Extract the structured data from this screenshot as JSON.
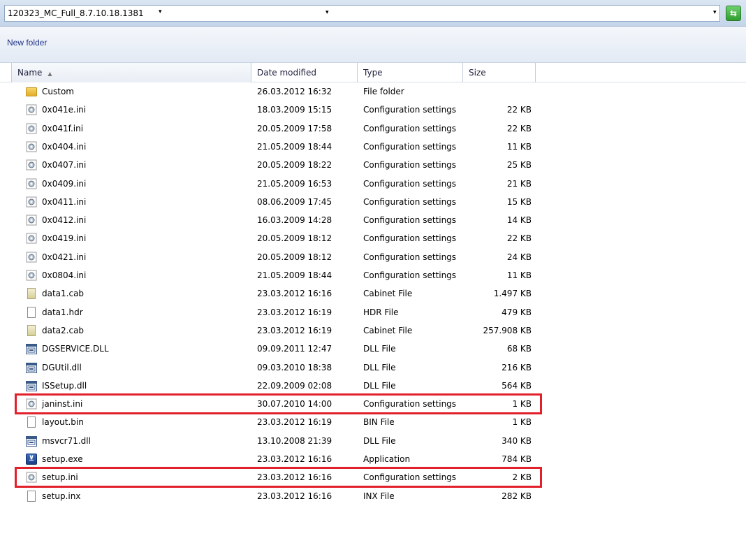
{
  "address": {
    "breadcrumb": "120323_MC_Full_8.7.10.18.1381",
    "arrow": "▾",
    "dropdown_arrow": "▾",
    "refresh_icon": "go-refresh-icon"
  },
  "toolbar": {
    "new_folder_label": "New folder"
  },
  "columns": {
    "name": "Name",
    "name_sort": "▲",
    "date": "Date modified",
    "type": "Type",
    "size": "Size"
  },
  "files": [
    {
      "name": "Custom",
      "date": "26.03.2012 16:32",
      "type": "File folder",
      "size": "",
      "icon": "folder-icon"
    },
    {
      "name": "0x041e.ini",
      "date": "18.03.2009 15:15",
      "type": "Configuration settings",
      "size": "22 KB",
      "icon": "ini-file-icon"
    },
    {
      "name": "0x041f.ini",
      "date": "20.05.2009 17:58",
      "type": "Configuration settings",
      "size": "22 KB",
      "icon": "ini-file-icon"
    },
    {
      "name": "0x0404.ini",
      "date": "21.05.2009 18:44",
      "type": "Configuration settings",
      "size": "11 KB",
      "icon": "ini-file-icon"
    },
    {
      "name": "0x0407.ini",
      "date": "20.05.2009 18:22",
      "type": "Configuration settings",
      "size": "25 KB",
      "icon": "ini-file-icon"
    },
    {
      "name": "0x0409.ini",
      "date": "21.05.2009 16:53",
      "type": "Configuration settings",
      "size": "21 KB",
      "icon": "ini-file-icon"
    },
    {
      "name": "0x0411.ini",
      "date": "08.06.2009 17:45",
      "type": "Configuration settings",
      "size": "15 KB",
      "icon": "ini-file-icon"
    },
    {
      "name": "0x0412.ini",
      "date": "16.03.2009 14:28",
      "type": "Configuration settings",
      "size": "14 KB",
      "icon": "ini-file-icon"
    },
    {
      "name": "0x0419.ini",
      "date": "20.05.2009 18:12",
      "type": "Configuration settings",
      "size": "22 KB",
      "icon": "ini-file-icon"
    },
    {
      "name": "0x0421.ini",
      "date": "20.05.2009 18:12",
      "type": "Configuration settings",
      "size": "24 KB",
      "icon": "ini-file-icon"
    },
    {
      "name": "0x0804.ini",
      "date": "21.05.2009 18:44",
      "type": "Configuration settings",
      "size": "11 KB",
      "icon": "ini-file-icon"
    },
    {
      "name": "data1.cab",
      "date": "23.03.2012 16:16",
      "type": "Cabinet File",
      "size": "1.497 KB",
      "icon": "cab-file-icon"
    },
    {
      "name": "data1.hdr",
      "date": "23.03.2012 16:19",
      "type": "HDR File",
      "size": "479 KB",
      "icon": "blank-file-icon"
    },
    {
      "name": "data2.cab",
      "date": "23.03.2012 16:19",
      "type": "Cabinet File",
      "size": "257.908 KB",
      "icon": "cab-file-icon"
    },
    {
      "name": "DGSERVICE.DLL",
      "date": "09.09.2011 12:47",
      "type": "DLL File",
      "size": "68 KB",
      "icon": "dll-file-icon"
    },
    {
      "name": "DGUtil.dll",
      "date": "09.03.2010 18:38",
      "type": "DLL File",
      "size": "216 KB",
      "icon": "dll-file-icon"
    },
    {
      "name": "ISSetup.dll",
      "date": "22.09.2009 02:08",
      "type": "DLL File",
      "size": "564 KB",
      "icon": "dll-file-icon"
    },
    {
      "name": "janinst.ini",
      "date": "30.07.2010 14:00",
      "type": "Configuration settings",
      "size": "1 KB",
      "icon": "ini-file-icon",
      "highlighted": true
    },
    {
      "name": "layout.bin",
      "date": "23.03.2012 16:19",
      "type": "BIN File",
      "size": "1 KB",
      "icon": "blank-file-icon"
    },
    {
      "name": "msvcr71.dll",
      "date": "13.10.2008 21:39",
      "type": "DLL File",
      "size": "340 KB",
      "icon": "dll-file-icon"
    },
    {
      "name": "setup.exe",
      "date": "23.03.2012 16:16",
      "type": "Application",
      "size": "784 KB",
      "icon": "exe-file-icon"
    },
    {
      "name": "setup.ini",
      "date": "23.03.2012 16:16",
      "type": "Configuration settings",
      "size": "2 KB",
      "icon": "ini-file-icon",
      "highlighted": true
    },
    {
      "name": "setup.inx",
      "date": "23.03.2012 16:16",
      "type": "INX File",
      "size": "282 KB",
      "icon": "blank-file-icon"
    }
  ],
  "colors": {
    "highlight_border": "#e2202a",
    "toolbar_text": "#1e3287"
  }
}
